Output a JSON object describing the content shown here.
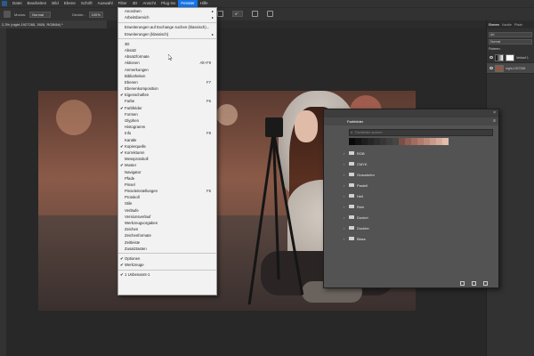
{
  "menubar": {
    "items": [
      "Datei",
      "Bearbeiten",
      "Bild",
      "Ebene",
      "Schrift",
      "Auswahl",
      "Filter",
      "3D",
      "Ansicht",
      "Plug-ins",
      "Fenster",
      "Hilfe"
    ],
    "active_index": 10
  },
  "options": {
    "mode_label": "Modus:",
    "mode_value": "Normal",
    "opacity_label": "Deckkr.:",
    "opacity_value": "100%",
    "angle_value": "0°"
  },
  "document": {
    "tab_title": "2,3% (night-1927265, 3926, RGB/8#) *"
  },
  "fenster_menu": {
    "items": [
      {
        "label": "Anordnen",
        "arrow": true
      },
      {
        "label": "Arbeitsbereich",
        "arrow": true
      },
      {
        "sep": true
      },
      {
        "label": "Erweiterungen auf Exchange suchen (klassisch)..."
      },
      {
        "label": "Erweiterungen (klassisch)",
        "arrow": true
      },
      {
        "sep": true
      },
      {
        "label": "3D"
      },
      {
        "label": "Absatz"
      },
      {
        "label": "Absatzformate"
      },
      {
        "label": "Aktionen",
        "shortcut": "Alt+F9"
      },
      {
        "label": "Anmerkungen"
      },
      {
        "label": "Bibliotheken"
      },
      {
        "label": "Ebenen",
        "shortcut": "F7"
      },
      {
        "label": "Ebenenkomposition"
      },
      {
        "label": "Eigenschaften",
        "checked": true
      },
      {
        "label": "Farbe",
        "shortcut": "F6"
      },
      {
        "label": "Farbfelder",
        "checked": true
      },
      {
        "label": "Formen"
      },
      {
        "label": "Glyphen"
      },
      {
        "label": "Histogramm"
      },
      {
        "label": "Info",
        "shortcut": "F8"
      },
      {
        "label": "Kanäle"
      },
      {
        "label": "Kopierquelle",
        "checked": true
      },
      {
        "label": "Korrekturen",
        "checked": true
      },
      {
        "label": "Messprotokoll"
      },
      {
        "label": "Muster",
        "checked": true
      },
      {
        "label": "Navigator"
      },
      {
        "label": "Pfade"
      },
      {
        "label": "Pinsel"
      },
      {
        "label": "Pinseleinstellungen",
        "shortcut": "F5"
      },
      {
        "label": "Protokoll"
      },
      {
        "label": "Stile"
      },
      {
        "label": "Verläufe"
      },
      {
        "label": "Versionsverlauf"
      },
      {
        "label": "Werkzeugvorgaben"
      },
      {
        "label": "Zeichen"
      },
      {
        "label": "Zeichenformate"
      },
      {
        "label": "Zeitleiste"
      },
      {
        "label": "Zusatztasten"
      },
      {
        "sep": true
      },
      {
        "label": "Optionen",
        "checked": true
      },
      {
        "label": "Werkzeuge",
        "checked": true
      },
      {
        "sep": true
      },
      {
        "label": "1 Unbenannt-1",
        "checked": true
      }
    ]
  },
  "layers_panel": {
    "tabs": [
      "Ebenen",
      "Kanäle",
      "Pfade"
    ],
    "active_tab": 0,
    "filter_value": "Art",
    "blend_mode": "Normal",
    "lock_label": "Fixieren:",
    "layers": [
      {
        "name": "Verlauf 1"
      },
      {
        "name": "night-1927265"
      }
    ]
  },
  "swatches_panel": {
    "title": "Farbfelder",
    "search_placeholder": "Farbfelder suchen",
    "recent_colors": [
      "#0a0a0a",
      "#141414",
      "#1e1e1e",
      "#262626",
      "#2e2e2e",
      "#363636",
      "#3e3e3e",
      "#454545",
      "#7a4e46",
      "#915e54",
      "#a36c60",
      "#b07a6c",
      "#bc8a7a",
      "#c89a8a",
      "#d6aa9a",
      "#e2bcad"
    ],
    "groups": [
      "RGB",
      "CMYK",
      "Graustufen",
      "Pastell",
      "Hell",
      "Rein",
      "Dunkel",
      "Dunkler",
      "Blass"
    ]
  }
}
